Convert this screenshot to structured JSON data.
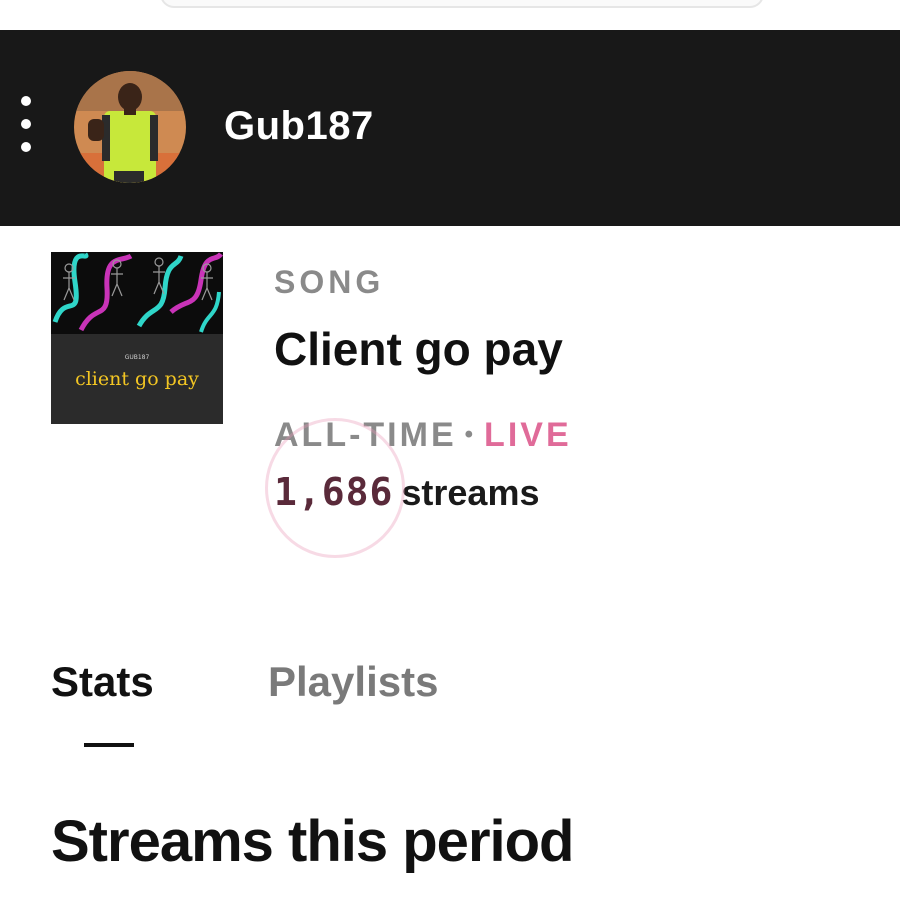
{
  "header": {
    "artist_name": "Gub187",
    "menu_icon": "more-vert-icon",
    "avatar_icon": "artist-avatar"
  },
  "song": {
    "type_label": "SONG",
    "title": "Client go pay",
    "cover_title": "client go pay",
    "cover_small_text": "GUB187",
    "period_label": "ALL-TIME",
    "separator": "•",
    "live_label": "LIVE",
    "streams_count": "1,686",
    "streams_label": "streams"
  },
  "tabs": [
    {
      "label": "Stats",
      "active": true
    },
    {
      "label": "Playlists",
      "active": false
    }
  ],
  "section": {
    "title": "Streams this period"
  },
  "colors": {
    "header_bg": "#181818",
    "live": "#e06b99",
    "streams_count": "#5a2a3a",
    "cover_title": "#f3c623",
    "muted": "#8a8a8a"
  }
}
